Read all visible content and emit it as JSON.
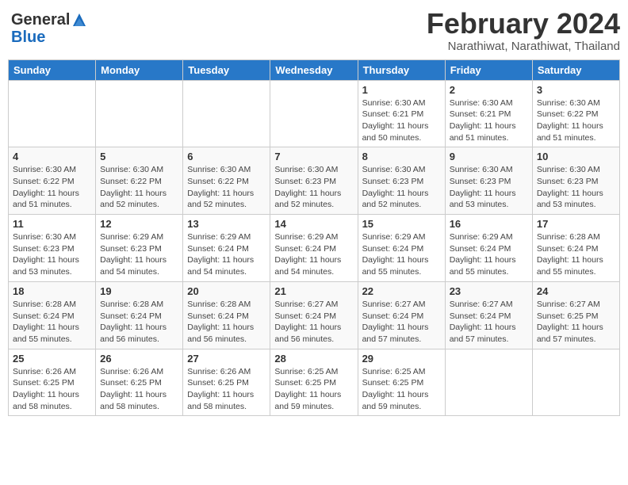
{
  "header": {
    "logo_general": "General",
    "logo_blue": "Blue",
    "month_year": "February 2024",
    "location": "Narathiwat, Narathiwat, Thailand"
  },
  "weekdays": [
    "Sunday",
    "Monday",
    "Tuesday",
    "Wednesday",
    "Thursday",
    "Friday",
    "Saturday"
  ],
  "weeks": [
    [
      {
        "day": "",
        "detail": ""
      },
      {
        "day": "",
        "detail": ""
      },
      {
        "day": "",
        "detail": ""
      },
      {
        "day": "",
        "detail": ""
      },
      {
        "day": "1",
        "detail": "Sunrise: 6:30 AM\nSunset: 6:21 PM\nDaylight: 11 hours and 50 minutes."
      },
      {
        "day": "2",
        "detail": "Sunrise: 6:30 AM\nSunset: 6:21 PM\nDaylight: 11 hours and 51 minutes."
      },
      {
        "day": "3",
        "detail": "Sunrise: 6:30 AM\nSunset: 6:22 PM\nDaylight: 11 hours and 51 minutes."
      }
    ],
    [
      {
        "day": "4",
        "detail": "Sunrise: 6:30 AM\nSunset: 6:22 PM\nDaylight: 11 hours and 51 minutes."
      },
      {
        "day": "5",
        "detail": "Sunrise: 6:30 AM\nSunset: 6:22 PM\nDaylight: 11 hours and 52 minutes."
      },
      {
        "day": "6",
        "detail": "Sunrise: 6:30 AM\nSunset: 6:22 PM\nDaylight: 11 hours and 52 minutes."
      },
      {
        "day": "7",
        "detail": "Sunrise: 6:30 AM\nSunset: 6:23 PM\nDaylight: 11 hours and 52 minutes."
      },
      {
        "day": "8",
        "detail": "Sunrise: 6:30 AM\nSunset: 6:23 PM\nDaylight: 11 hours and 52 minutes."
      },
      {
        "day": "9",
        "detail": "Sunrise: 6:30 AM\nSunset: 6:23 PM\nDaylight: 11 hours and 53 minutes."
      },
      {
        "day": "10",
        "detail": "Sunrise: 6:30 AM\nSunset: 6:23 PM\nDaylight: 11 hours and 53 minutes."
      }
    ],
    [
      {
        "day": "11",
        "detail": "Sunrise: 6:30 AM\nSunset: 6:23 PM\nDaylight: 11 hours and 53 minutes."
      },
      {
        "day": "12",
        "detail": "Sunrise: 6:29 AM\nSunset: 6:23 PM\nDaylight: 11 hours and 54 minutes."
      },
      {
        "day": "13",
        "detail": "Sunrise: 6:29 AM\nSunset: 6:24 PM\nDaylight: 11 hours and 54 minutes."
      },
      {
        "day": "14",
        "detail": "Sunrise: 6:29 AM\nSunset: 6:24 PM\nDaylight: 11 hours and 54 minutes."
      },
      {
        "day": "15",
        "detail": "Sunrise: 6:29 AM\nSunset: 6:24 PM\nDaylight: 11 hours and 55 minutes."
      },
      {
        "day": "16",
        "detail": "Sunrise: 6:29 AM\nSunset: 6:24 PM\nDaylight: 11 hours and 55 minutes."
      },
      {
        "day": "17",
        "detail": "Sunrise: 6:28 AM\nSunset: 6:24 PM\nDaylight: 11 hours and 55 minutes."
      }
    ],
    [
      {
        "day": "18",
        "detail": "Sunrise: 6:28 AM\nSunset: 6:24 PM\nDaylight: 11 hours and 55 minutes."
      },
      {
        "day": "19",
        "detail": "Sunrise: 6:28 AM\nSunset: 6:24 PM\nDaylight: 11 hours and 56 minutes."
      },
      {
        "day": "20",
        "detail": "Sunrise: 6:28 AM\nSunset: 6:24 PM\nDaylight: 11 hours and 56 minutes."
      },
      {
        "day": "21",
        "detail": "Sunrise: 6:27 AM\nSunset: 6:24 PM\nDaylight: 11 hours and 56 minutes."
      },
      {
        "day": "22",
        "detail": "Sunrise: 6:27 AM\nSunset: 6:24 PM\nDaylight: 11 hours and 57 minutes."
      },
      {
        "day": "23",
        "detail": "Sunrise: 6:27 AM\nSunset: 6:24 PM\nDaylight: 11 hours and 57 minutes."
      },
      {
        "day": "24",
        "detail": "Sunrise: 6:27 AM\nSunset: 6:25 PM\nDaylight: 11 hours and 57 minutes."
      }
    ],
    [
      {
        "day": "25",
        "detail": "Sunrise: 6:26 AM\nSunset: 6:25 PM\nDaylight: 11 hours and 58 minutes."
      },
      {
        "day": "26",
        "detail": "Sunrise: 6:26 AM\nSunset: 6:25 PM\nDaylight: 11 hours and 58 minutes."
      },
      {
        "day": "27",
        "detail": "Sunrise: 6:26 AM\nSunset: 6:25 PM\nDaylight: 11 hours and 58 minutes."
      },
      {
        "day": "28",
        "detail": "Sunrise: 6:25 AM\nSunset: 6:25 PM\nDaylight: 11 hours and 59 minutes."
      },
      {
        "day": "29",
        "detail": "Sunrise: 6:25 AM\nSunset: 6:25 PM\nDaylight: 11 hours and 59 minutes."
      },
      {
        "day": "",
        "detail": ""
      },
      {
        "day": "",
        "detail": ""
      }
    ]
  ]
}
